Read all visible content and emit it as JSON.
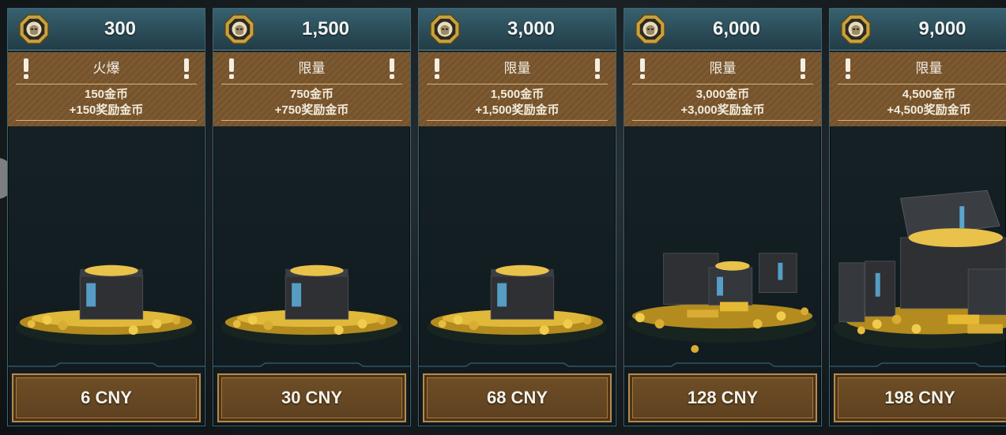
{
  "colors": {
    "header_teal": "#2a4b56",
    "promo_brown": "#7d5a31",
    "gold_coin": "#e9c24c",
    "button_brown": "#6e4e26"
  },
  "packs": [
    {
      "amount": "300",
      "tag": "火爆",
      "bonus_line1": "150金币",
      "bonus_line2": "+150奖励金币",
      "price": "6 CNY",
      "art": "small-chest-coins"
    },
    {
      "amount": "1,500",
      "tag": "限量",
      "bonus_line1": "750金币",
      "bonus_line2": "+750奖励金币",
      "price": "30 CNY",
      "art": "small-chest-coins"
    },
    {
      "amount": "3,000",
      "tag": "限量",
      "bonus_line1": "1,500金币",
      "bonus_line2": "+1,500奖励金币",
      "price": "68 CNY",
      "art": "small-chest-coins"
    },
    {
      "amount": "6,000",
      "tag": "限量",
      "bonus_line1": "3,000金币",
      "bonus_line2": "+3,000奖励金币",
      "price": "128 CNY",
      "art": "multiple-crates-coins"
    },
    {
      "amount": "9,000",
      "tag": "限量",
      "bonus_line1": "4,500金币",
      "bonus_line2": "+4,500奖励金币",
      "price": "198 CNY",
      "art": "large-open-chest-coins"
    }
  ]
}
